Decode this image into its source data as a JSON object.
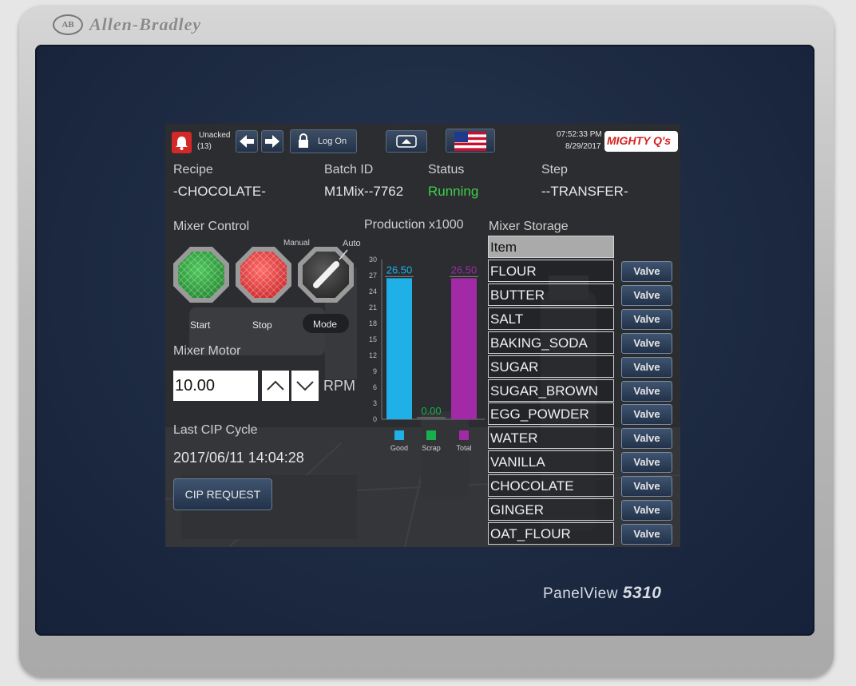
{
  "device": {
    "brand": "Allen-Bradley",
    "brand_logo": "AB",
    "model_prefix": "PanelView",
    "model_number": "5310"
  },
  "header": {
    "alarm_label": "Unacked",
    "alarm_count": "(13)",
    "logon_label": "Log On",
    "time": "07:52:33 PM",
    "date": "8/29/2017",
    "logo_text": "MIGHTY Q's"
  },
  "summary": {
    "recipe_label": "Recipe",
    "recipe_value": "-CHOCOLATE-",
    "batch_label": "Batch ID",
    "batch_value": "M1Mix--7762",
    "status_label": "Status",
    "status_value": "Running",
    "step_label": "Step",
    "step_value": "--TRANSFER-"
  },
  "mixer_control": {
    "title": "Mixer Control",
    "manual_label": "Manual",
    "auto_label": "Auto",
    "start_label": "Start",
    "stop_label": "Stop",
    "mode_label": "Mode"
  },
  "mixer_motor": {
    "title": "Mixer Motor",
    "value": "10.00",
    "unit": "RPM"
  },
  "cip": {
    "title": "Last CIP Cycle",
    "timestamp": "2017/06/11 14:04:28",
    "button_label": "CIP REQUEST"
  },
  "chart_data": {
    "type": "bar",
    "title": "Production x1000",
    "categories": [
      "Good",
      "Scrap",
      "Total"
    ],
    "values": [
      26.5,
      0.0,
      26.5
    ],
    "value_labels": [
      "26.50",
      "0.00",
      "26.50"
    ],
    "colors": [
      "#1fb0e8",
      "#17b04a",
      "#a22aa6"
    ],
    "ylim": [
      0,
      30
    ],
    "yticks": [
      "0",
      "3",
      "6",
      "9",
      "12",
      "15",
      "18",
      "21",
      "24",
      "27",
      "30"
    ],
    "grid": false
  },
  "storage": {
    "title": "Mixer Storage",
    "column_header": "Item",
    "valve_label": "Valve",
    "items": [
      "FLOUR",
      "BUTTER",
      "SALT",
      "BAKING_SODA",
      "SUGAR",
      "SUGAR_BROWN",
      "EGG_POWDER",
      "WATER",
      "VANILLA",
      "CHOCOLATE",
      "GINGER",
      "OAT_FLOUR"
    ]
  },
  "colors": {
    "status_running": "#3fcf4a",
    "start_button": "#2a9a3a",
    "stop_button": "#e83a3a"
  }
}
